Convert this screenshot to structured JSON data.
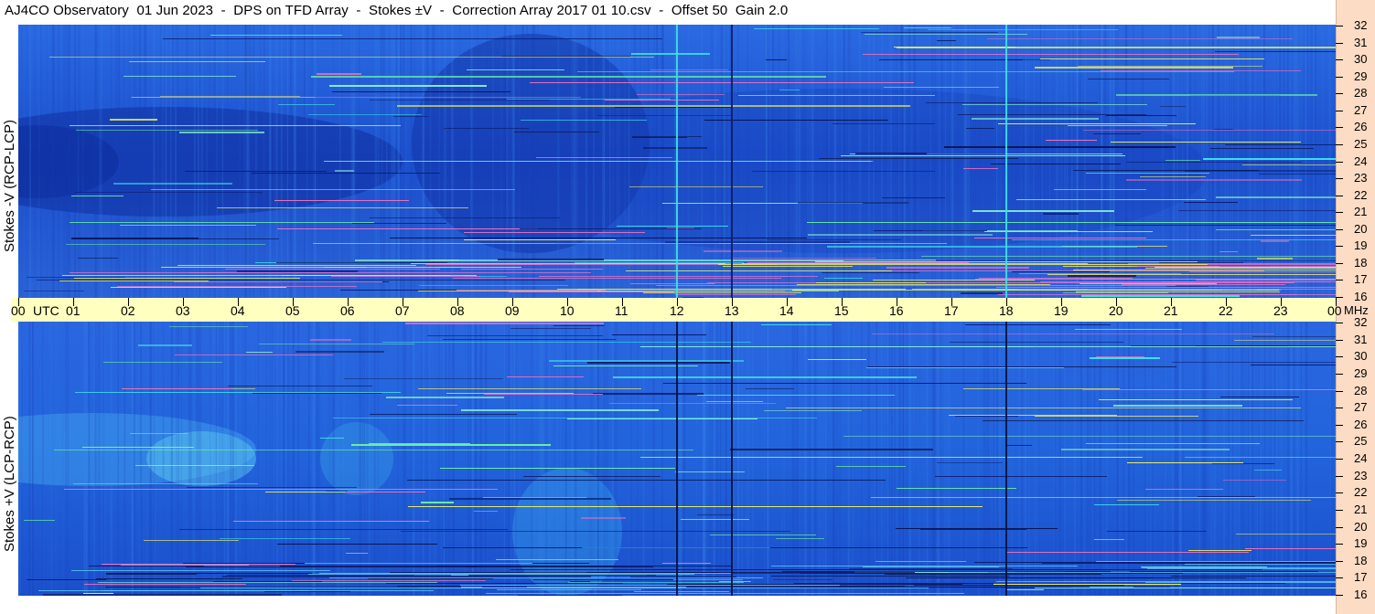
{
  "title": "AJ4CO Observatory  01 Jun 2023  -  DPS on TFD Array  -  Stokes ±V  -  Correction Array 2017 01 10.csv  -  Offset 50  Gain 2.0",
  "top_panel": {
    "ylabel": "Stokes -V (RCP-LCP)"
  },
  "bottom_panel": {
    "ylabel": "Stokes +V (LCP-RCP)"
  },
  "colors": {
    "background_blue": "#1f55d8",
    "timebar": "#ffffc0",
    "right_strip": "#fcdcc4"
  },
  "chart_data": {
    "type": "heatmap",
    "title": "AJ4CO Observatory  01 Jun 2023  -  DPS on TFD Array  -  Stokes ±V  -  Correction Array 2017 01 10.csv  -  Offset 50  Gain 2.0",
    "x_unit": "UTC",
    "y_unit": "MHz",
    "x_ticks": [
      "00",
      "01",
      "02",
      "03",
      "04",
      "05",
      "06",
      "07",
      "08",
      "09",
      "10",
      "11",
      "12",
      "13",
      "14",
      "15",
      "16",
      "17",
      "18",
      "19",
      "20",
      "21",
      "22",
      "23",
      "00"
    ],
    "y_ticks": [
      "32",
      "31",
      "30",
      "29",
      "28",
      "27",
      "26",
      "25",
      "24",
      "23",
      "22",
      "21",
      "20",
      "19",
      "18",
      "17",
      "16"
    ],
    "xlim": [
      0,
      24
    ],
    "ylim": [
      16,
      32
    ],
    "grid": false
  }
}
